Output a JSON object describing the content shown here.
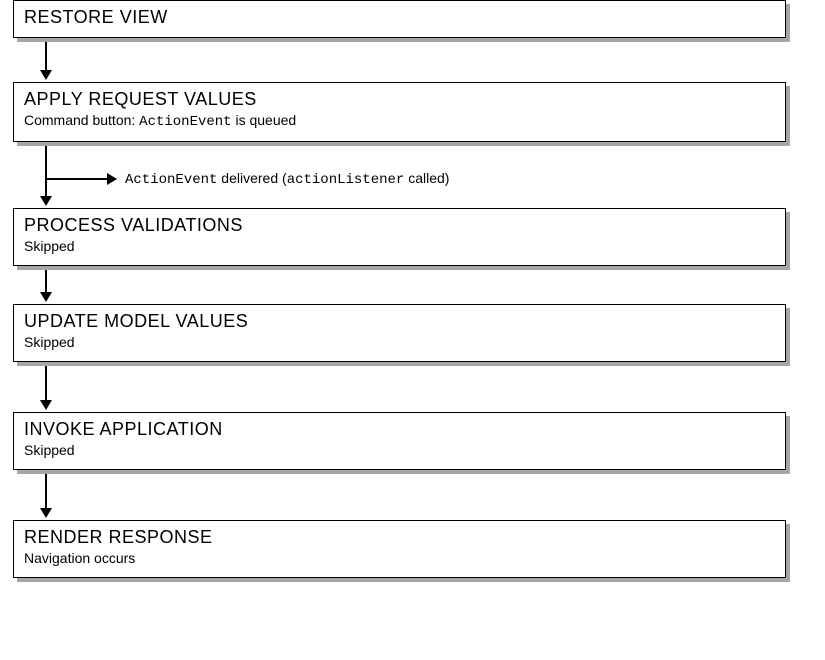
{
  "phases": {
    "restore": {
      "title": "RESTORE VIEW"
    },
    "apply": {
      "title": "APPLY REQUEST VALUES",
      "sub_prefix": "Command button: ",
      "sub_code": "ActionEvent",
      "sub_suffix": " is queued"
    },
    "branch": {
      "code1": "ActionEvent",
      "mid": " delivered (",
      "code2": "actionListener",
      "suffix": " called)"
    },
    "process": {
      "title": "PROCESS VALIDATIONS",
      "sub": "Skipped"
    },
    "update": {
      "title": "UPDATE MODEL VALUES",
      "sub": "Skipped"
    },
    "invoke": {
      "title": "INVOKE APPLICATION",
      "sub": "Skipped"
    },
    "render": {
      "title": "RENDER RESPONSE",
      "sub": "Navigation occurs"
    }
  }
}
